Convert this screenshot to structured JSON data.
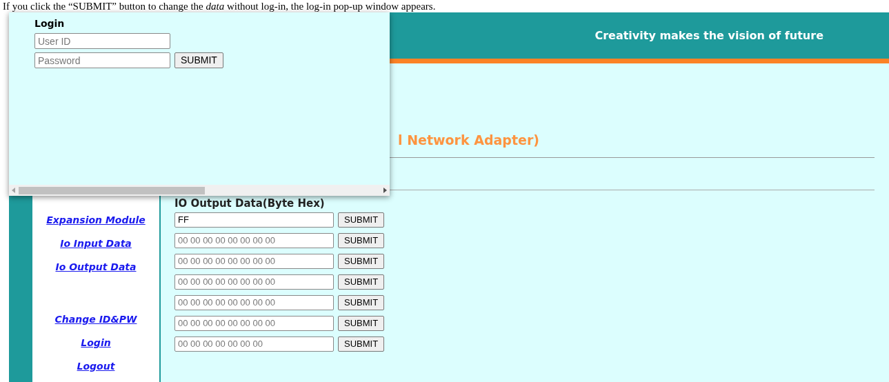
{
  "caption": "If you click the “SUBMIT” button to change the *data* without log-in, the log-in pop-up window appears.",
  "header": {
    "slogan": "Creativity makes the vision of future"
  },
  "content": {
    "heading": "l Network Adapter)",
    "section_title": "IO Output Data(Byte Hex)",
    "rows": [
      {
        "value": "FF",
        "button": "SUBMIT"
      },
      {
        "placeholder": "00 00 00 00 00 00 00 00",
        "button": "SUBMIT"
      },
      {
        "placeholder": "00 00 00 00 00 00 00 00",
        "button": "SUBMIT"
      },
      {
        "placeholder": "00 00 00 00 00 00 00 00",
        "button": "SUBMIT"
      },
      {
        "placeholder": "00 00 00 00 00 00 00 00",
        "button": "SUBMIT"
      },
      {
        "placeholder": "00 00 00 00 00 00 00 00",
        "button": "SUBMIT"
      },
      {
        "placeholder": "00 00 00 00 00 00 00",
        "button": "SUBMIT"
      }
    ]
  },
  "sidebar": {
    "groups": [
      [
        "Expansion Module",
        "Io Input Data",
        "Io Output Data"
      ],
      [
        "Change ID&PW",
        "Login",
        "Logout"
      ]
    ]
  },
  "popup": {
    "title": "Login",
    "user_placeholder": "User ID",
    "password_placeholder": "Password",
    "button": "SUBMIT"
  }
}
